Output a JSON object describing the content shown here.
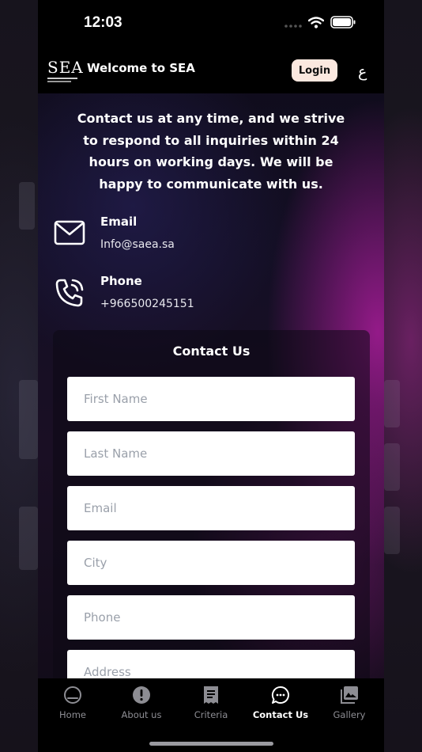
{
  "status": {
    "time": "12:03"
  },
  "header": {
    "logo_text": "SEA",
    "title": "Welcome to SEA",
    "login_label": "Login",
    "language_toggle": "ع"
  },
  "intro": "Contact us at any time, and we strive to respond to all inquiries within 24 hours on working days. We will be happy to communicate with us.",
  "contacts": [
    {
      "label": "Email",
      "value": "Info@saea.sa",
      "icon": "envelope-icon"
    },
    {
      "label": "Phone",
      "value": "+966500245151",
      "icon": "phone-icon"
    }
  ],
  "form": {
    "title": "Contact Us",
    "fields": [
      {
        "placeholder": "First Name"
      },
      {
        "placeholder": "Last Name"
      },
      {
        "placeholder": "Email"
      },
      {
        "placeholder": "City"
      },
      {
        "placeholder": "Phone"
      },
      {
        "placeholder": "Address"
      }
    ]
  },
  "tabs": [
    {
      "label": "Home",
      "icon": "home-icon"
    },
    {
      "label": "About us",
      "icon": "info-icon"
    },
    {
      "label": "Criteria",
      "icon": "receipt-icon"
    },
    {
      "label": "Contact Us",
      "icon": "chat-icon",
      "active": true
    },
    {
      "label": "Gallery",
      "icon": "gallery-icon"
    }
  ],
  "colors": {
    "bar_background": "#000000",
    "login_button": "#fbe8df",
    "accent_glow": "#be1eaa",
    "inactive_tab": "#8d8d93"
  }
}
